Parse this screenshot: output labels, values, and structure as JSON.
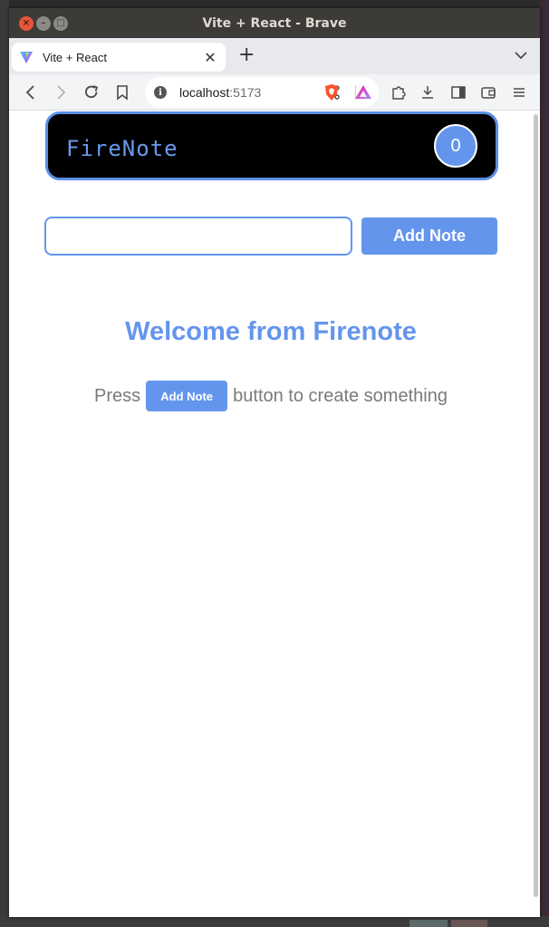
{
  "window": {
    "title": "Vite + React - Brave"
  },
  "tab": {
    "title": "Vite + React",
    "close_glyph": "✕"
  },
  "tabstrip": {
    "new_tab_glyph": "+",
    "menu_glyph": "⌄"
  },
  "urlbar": {
    "host": "localhost",
    "port": ":5173"
  },
  "app": {
    "brand": "FireNote",
    "note_count": "0",
    "input_value": "",
    "add_button_label": "Add Note",
    "welcome_heading": "Welcome from Firenote",
    "hint_prefix": "Press",
    "hint_button_label": "Add Note",
    "hint_suffix": "button to create something"
  },
  "colors": {
    "accent": "#6495ED",
    "header_bg": "#000000",
    "hint_text": "#7A7A7A"
  },
  "icons": {
    "back": "back-icon",
    "forward": "forward-icon",
    "reload": "reload-icon",
    "bookmark": "bookmark-icon",
    "share": "share-icon",
    "brave_shields": "brave-shields-icon",
    "brave_rewards": "brave-rewards-icon",
    "extensions": "puzzle-icon",
    "downloads": "download-icon",
    "sidebar": "sidebar-icon",
    "wallet": "wallet-icon",
    "menu": "hamburger-icon"
  }
}
